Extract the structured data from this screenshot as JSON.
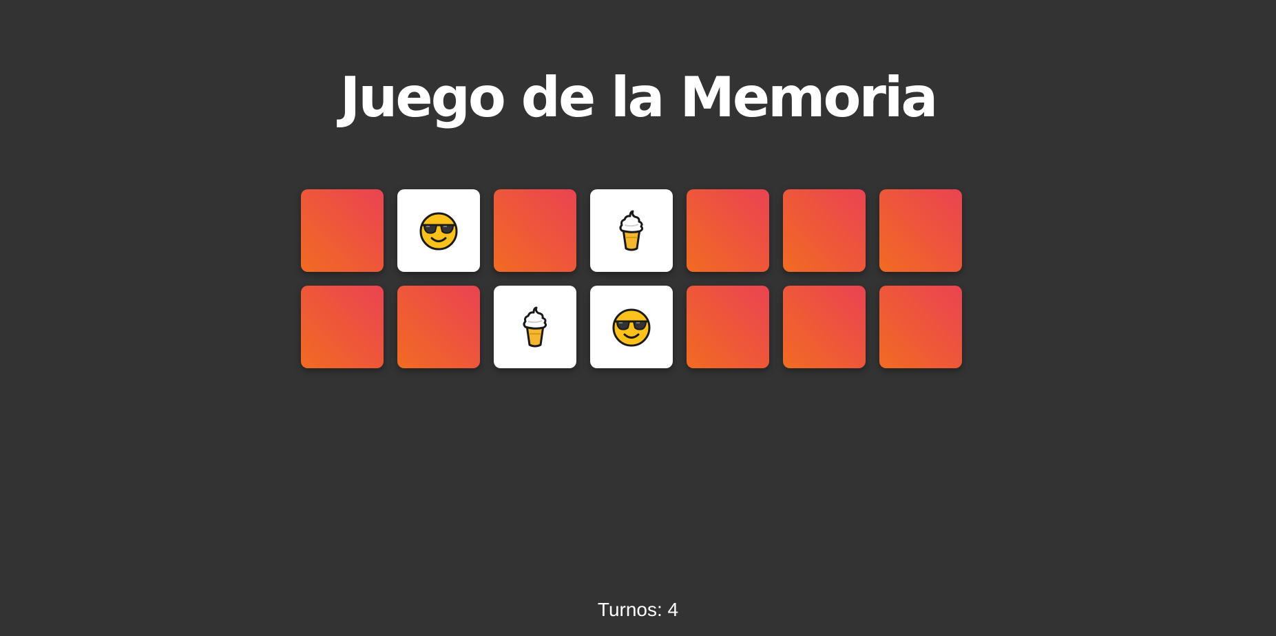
{
  "title": "Juego de la Memoria",
  "turns": {
    "label": "Turnos:",
    "value": "4"
  },
  "colors": {
    "background": "#333333",
    "card_back_start": "#f26b22",
    "card_back_end": "#ea4352",
    "card_face": "#ffffff"
  },
  "cards": [
    {
      "state": "hidden",
      "icon": ""
    },
    {
      "state": "revealed",
      "icon": "sunglasses-face-icon"
    },
    {
      "state": "hidden",
      "icon": ""
    },
    {
      "state": "revealed",
      "icon": "ice-cream-icon"
    },
    {
      "state": "hidden",
      "icon": ""
    },
    {
      "state": "hidden",
      "icon": ""
    },
    {
      "state": "hidden",
      "icon": ""
    },
    {
      "state": "hidden",
      "icon": ""
    },
    {
      "state": "hidden",
      "icon": ""
    },
    {
      "state": "revealed",
      "icon": "ice-cream-icon"
    },
    {
      "state": "revealed",
      "icon": "sunglasses-face-icon"
    },
    {
      "state": "hidden",
      "icon": ""
    },
    {
      "state": "hidden",
      "icon": ""
    },
    {
      "state": "hidden",
      "icon": ""
    }
  ]
}
